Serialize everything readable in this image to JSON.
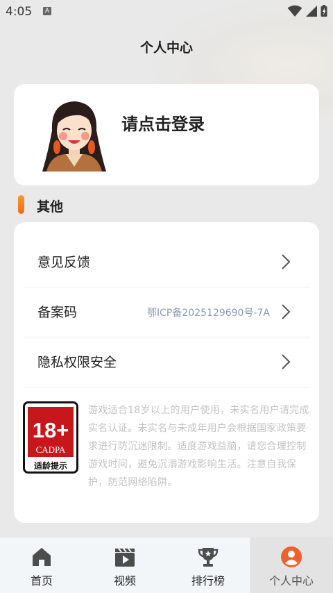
{
  "status_bar": {
    "time": "4:05",
    "notification_icon": "A"
  },
  "header": {
    "title": "个人中心"
  },
  "profile": {
    "login_prompt": "请点击登录",
    "avatar_icon": "avatar-illustration"
  },
  "section": {
    "title": "其他",
    "accent_color": "#f57a1f"
  },
  "menu": {
    "items": [
      {
        "label": "意见反馈",
        "value": ""
      },
      {
        "label": "备案码",
        "value": "鄂ICP备2025129690号-7A"
      },
      {
        "label": "隐私权限安全",
        "value": ""
      }
    ]
  },
  "age_rating": {
    "badge_number": "18+",
    "badge_org": "CADPA",
    "badge_caption": "适龄提示",
    "badge_color": "#c8171c",
    "notice": "游戏适合18岁以上的用户使用，未实名用户请完成实名认证。未实名与未成年用户会根据国家政策要求进行防沉迷限制。适度游戏益脑，请您合理控制游戏时间，避免沉溺游戏影响生活。注意自我保护，防范网络陷阱。"
  },
  "bottom_nav": {
    "active_index": 3,
    "items": [
      {
        "label": "首页",
        "icon": "home-icon"
      },
      {
        "label": "视频",
        "icon": "video-icon"
      },
      {
        "label": "排行榜",
        "icon": "trophy-icon"
      },
      {
        "label": "个人中心",
        "icon": "user-icon"
      }
    ]
  }
}
